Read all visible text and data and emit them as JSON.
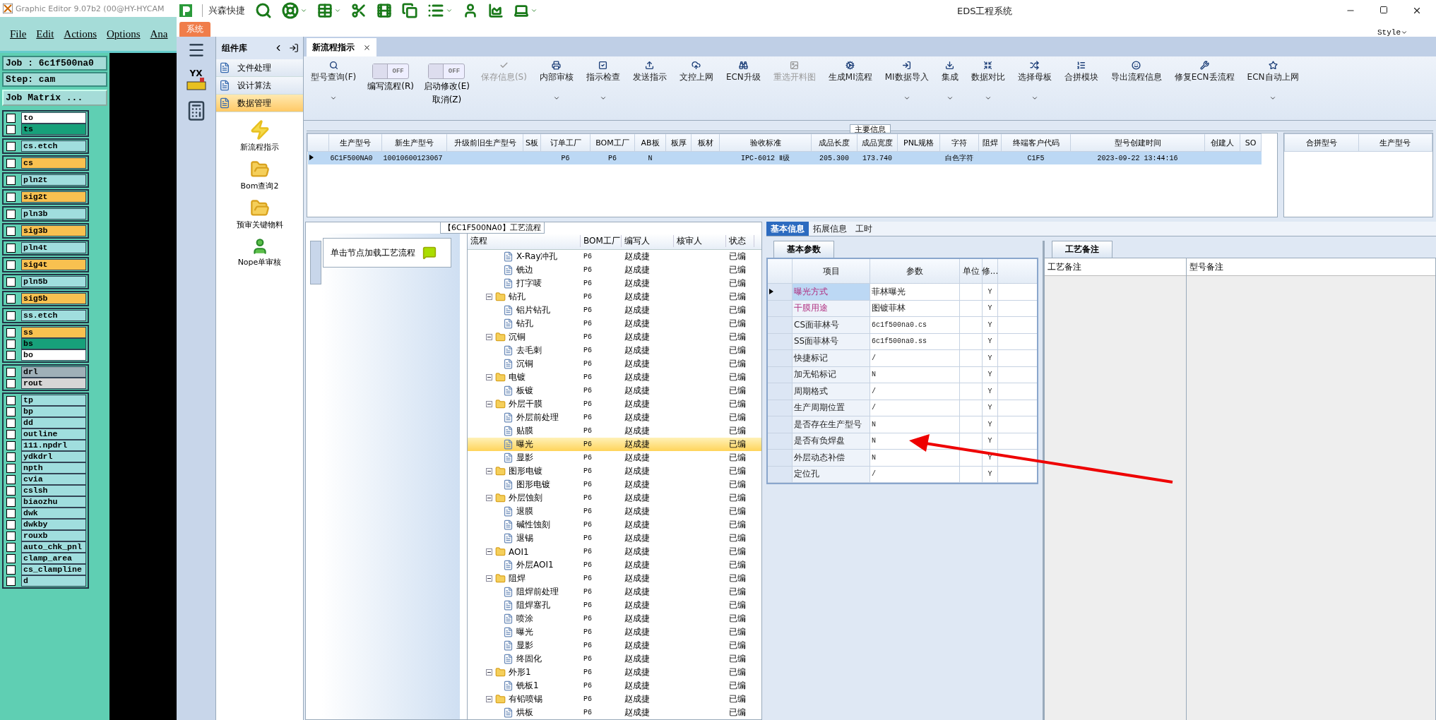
{
  "graphic_editor": {
    "title": "Graphic Editor 9.07b2 (00@HY-HYCAM",
    "menu": [
      "File",
      "Edit",
      "Actions",
      "Options",
      "Ana"
    ],
    "job": "Job : 6c1f500na0",
    "step": "Step: cam",
    "matrix_button": "Job Matrix ...",
    "layer_groups": [
      [
        {
          "name": "to",
          "color": "#ffffff",
          "checked": false
        },
        {
          "name": "ts",
          "color": "#17a07a",
          "checked": false
        }
      ],
      [
        {
          "name": "cs.etch",
          "color": "#a0dede",
          "checked": false
        }
      ],
      [
        {
          "name": "cs",
          "color": "#f8c150",
          "checked": false
        }
      ],
      [
        {
          "name": "pln2t",
          "color": "#a0dede",
          "checked": false
        }
      ],
      [
        {
          "name": "sig2t",
          "color": "#f8c150",
          "checked": false
        }
      ],
      [
        {
          "name": "pln3b",
          "color": "#a0dede",
          "checked": false
        }
      ],
      [
        {
          "name": "sig3b",
          "color": "#f8c150",
          "checked": false
        }
      ],
      [
        {
          "name": "pln4t",
          "color": "#a0dede",
          "checked": false
        }
      ],
      [
        {
          "name": "sig4t",
          "color": "#f8c150",
          "checked": false
        }
      ],
      [
        {
          "name": "pln5b",
          "color": "#a0dede",
          "checked": false
        }
      ],
      [
        {
          "name": "sig5b",
          "color": "#f8c150",
          "checked": false
        }
      ],
      [
        {
          "name": "ss.etch",
          "color": "#a0dede",
          "checked": false
        }
      ],
      [
        {
          "name": "ss",
          "color": "#f8c150",
          "checked": false
        },
        {
          "name": "bs",
          "color": "#17a07a",
          "checked": false
        },
        {
          "name": "bo",
          "color": "#ffffff",
          "checked": false
        }
      ],
      [
        {
          "name": "drl",
          "color": "#9fb0b8",
          "checked": false
        },
        {
          "name": "rout",
          "color": "#d6d6d6",
          "checked": false
        }
      ],
      [
        {
          "name": "tp",
          "color": "#a0dede",
          "checked": false
        },
        {
          "name": "bp",
          "color": "#a0dede",
          "checked": false
        },
        {
          "name": "dd",
          "color": "#a0dede",
          "checked": false
        },
        {
          "name": "outline",
          "color": "#a0dede",
          "checked": false
        },
        {
          "name": "111.npdrl",
          "color": "#a0dede",
          "checked": false
        },
        {
          "name": "ydkdrl",
          "color": "#a0dede",
          "checked": false
        },
        {
          "name": "npth",
          "color": "#a0dede",
          "checked": false
        },
        {
          "name": "cvia",
          "color": "#a0dede",
          "checked": false
        },
        {
          "name": "cslsh",
          "color": "#a0dede",
          "checked": false
        },
        {
          "name": "biaozhu",
          "color": "#a0dede",
          "checked": false
        },
        {
          "name": "dwk",
          "color": "#a0dede",
          "checked": false
        },
        {
          "name": "dwkby",
          "color": "#a0dede",
          "checked": false
        },
        {
          "name": "rouxb",
          "color": "#a0dede",
          "checked": false
        },
        {
          "name": "auto_chk_pnl",
          "color": "#a0dede",
          "checked": false
        },
        {
          "name": "clamp_area",
          "color": "#a0dede",
          "checked": false
        },
        {
          "name": "cs_clampline",
          "color": "#a0dede",
          "checked": false
        },
        {
          "name": "d",
          "color": "#a0dede",
          "checked": false
        }
      ]
    ]
  },
  "window": {
    "brand": "兴森快捷",
    "title": "EDS工程系统",
    "ribbon_tab": "系统",
    "logo_text": "YX",
    "style_menu": "Style"
  },
  "component_library": {
    "title": "组件库",
    "items": [
      {
        "label": "文件处理",
        "selected": false
      },
      {
        "label": "设计算法",
        "selected": false
      },
      {
        "label": "数据管理",
        "selected": true
      }
    ],
    "tools": [
      "新流程指示",
      "Bom查询2",
      "预审关键物料",
      "Nope单审核"
    ]
  },
  "document_tab": "新流程指示",
  "toolbar": [
    {
      "kind": "button",
      "label": "型号查询(F)",
      "dropdown": true,
      "disabled": false
    },
    {
      "kind": "toggle",
      "on": false,
      "state_text": "OFF",
      "lines": [
        "编写流程(R)"
      ]
    },
    {
      "kind": "toggle",
      "on": false,
      "state_text": "OFF",
      "lines": [
        "启动修改(E)",
        "取消(Z)"
      ]
    },
    {
      "kind": "button",
      "label": "保存信息(S)",
      "dropdown": false,
      "disabled": true
    },
    {
      "kind": "button",
      "label": "内部审核",
      "dropdown": true,
      "disabled": false
    },
    {
      "kind": "button",
      "label": "指示检查",
      "dropdown": true,
      "disabled": false
    },
    {
      "kind": "button",
      "label": "发送指示",
      "dropdown": false,
      "disabled": false
    },
    {
      "kind": "button",
      "label": "文控上网",
      "dropdown": false,
      "disabled": false
    },
    {
      "kind": "button",
      "label": "ECN升级",
      "dropdown": false,
      "disabled": false
    },
    {
      "kind": "button",
      "label": "重选开料图",
      "dropdown": false,
      "disabled": true
    },
    {
      "kind": "button",
      "label": "生成MI流程",
      "dropdown": false,
      "disabled": false
    },
    {
      "kind": "button",
      "label": "MI数据导入",
      "dropdown": true,
      "disabled": false
    },
    {
      "kind": "button",
      "label": "集成",
      "dropdown": true,
      "disabled": false
    },
    {
      "kind": "button",
      "label": "数据对比",
      "dropdown": true,
      "disabled": false
    },
    {
      "kind": "button",
      "label": "选择母板",
      "dropdown": true,
      "disabled": false
    },
    {
      "kind": "button",
      "label": "合拼模块",
      "dropdown": false,
      "disabled": false
    },
    {
      "kind": "button",
      "label": "导出流程信息",
      "dropdown": false,
      "disabled": false
    },
    {
      "kind": "button",
      "label": "修复ECN丢流程",
      "dropdown": false,
      "disabled": false
    },
    {
      "kind": "button",
      "label": "ECN自动上网",
      "dropdown": true,
      "disabled": false
    }
  ],
  "main_info": {
    "caption": "主要信息",
    "columns": [
      "生产型号",
      "新生产型号",
      "升级前旧生产型号",
      "S板",
      "订单工厂",
      "BOM工厂",
      "AB板",
      "板厚",
      "板材",
      "验收标准",
      "成品长度",
      "成品宽度",
      "PNL规格",
      "字符",
      "阻焊",
      "终端客户代码",
      "型号创建时间",
      "创建人",
      "SO"
    ],
    "rows": [
      {
        "selected": true,
        "cells": [
          "6C1F500NA0",
          "10010600123067",
          null,
          null,
          "P6",
          "P6",
          "N",
          null,
          null,
          "IPC-6012 Ⅱ级",
          "205.300",
          "173.740",
          null,
          "白色字符",
          null,
          "C1F5",
          "2023-09-22 13:44:16",
          null,
          null
        ]
      }
    ],
    "side_columns": [
      "合拼型号",
      "生产型号"
    ]
  },
  "process": {
    "title": "【6C1F500NA0】工艺流程",
    "hint": "单击节点加载工艺流程",
    "columns": [
      "流程",
      "BOM工厂",
      "编写人",
      "核审人",
      "状态"
    ],
    "tree": [
      {
        "kind": "leaf",
        "name": "X-Ray冲孔",
        "bom": "P6",
        "writer": "赵成捷",
        "status": "已编",
        "selected": false
      },
      {
        "kind": "leaf",
        "name": "铣边",
        "bom": "P6",
        "writer": "赵成捷",
        "status": "已编",
        "selected": false
      },
      {
        "kind": "leaf",
        "name": "打字唛",
        "bom": "P6",
        "writer": "赵成捷",
        "status": "已编",
        "selected": false
      },
      {
        "kind": "folder",
        "name": "钻孔",
        "bom": "P6",
        "writer": "赵成捷",
        "status": "已编",
        "selected": false,
        "expanded": true,
        "children": [
          {
            "kind": "leaf",
            "name": "铝片钻孔",
            "bom": "P6",
            "writer": "赵成捷",
            "status": "已编",
            "selected": false
          },
          {
            "kind": "leaf",
            "name": "钻孔",
            "bom": "P6",
            "writer": "赵成捷",
            "status": "已编",
            "selected": false
          }
        ]
      },
      {
        "kind": "folder",
        "name": "沉铜",
        "bom": "P6",
        "writer": "赵成捷",
        "status": "已编",
        "selected": false,
        "expanded": true,
        "children": [
          {
            "kind": "leaf",
            "name": "去毛刺",
            "bom": "P6",
            "writer": "赵成捷",
            "status": "已编",
            "selected": false
          },
          {
            "kind": "leaf",
            "name": "沉铜",
            "bom": "P6",
            "writer": "赵成捷",
            "status": "已编",
            "selected": false
          }
        ]
      },
      {
        "kind": "folder",
        "name": "电镀",
        "bom": "P6",
        "writer": "赵成捷",
        "status": "已编",
        "selected": false,
        "expanded": true,
        "children": [
          {
            "kind": "leaf",
            "name": "板镀",
            "bom": "P6",
            "writer": "赵成捷",
            "status": "已编",
            "selected": false
          }
        ]
      },
      {
        "kind": "folder",
        "name": "外层干膜",
        "bom": "P6",
        "writer": "赵成捷",
        "status": "已编",
        "selected": false,
        "expanded": true,
        "children": [
          {
            "kind": "leaf",
            "name": "外层前处理",
            "bom": "P6",
            "writer": "赵成捷",
            "status": "已编",
            "selected": false
          },
          {
            "kind": "leaf",
            "name": "贴膜",
            "bom": "P6",
            "writer": "赵成捷",
            "status": "已编",
            "selected": false
          },
          {
            "kind": "leaf",
            "name": "曝光",
            "bom": "P6",
            "writer": "赵成捷",
            "status": "已编",
            "selected": true
          },
          {
            "kind": "leaf",
            "name": "显影",
            "bom": "P6",
            "writer": "赵成捷",
            "status": "已编",
            "selected": false
          }
        ]
      },
      {
        "kind": "folder",
        "name": "图形电镀",
        "bom": "P6",
        "writer": "赵成捷",
        "status": "已编",
        "selected": false,
        "expanded": true,
        "children": [
          {
            "kind": "leaf",
            "name": "图形电镀",
            "bom": "P6",
            "writer": "赵成捷",
            "status": "已编",
            "selected": false
          }
        ]
      },
      {
        "kind": "folder",
        "name": "外层蚀刻",
        "bom": "P6",
        "writer": "赵成捷",
        "status": "已编",
        "selected": false,
        "expanded": true,
        "children": [
          {
            "kind": "leaf",
            "name": "退膜",
            "bom": "P6",
            "writer": "赵成捷",
            "status": "已编",
            "selected": false
          },
          {
            "kind": "leaf",
            "name": "碱性蚀刻",
            "bom": "P6",
            "writer": "赵成捷",
            "status": "已编",
            "selected": false
          },
          {
            "kind": "leaf",
            "name": "退锡",
            "bom": "P6",
            "writer": "赵成捷",
            "status": "已编",
            "selected": false
          }
        ]
      },
      {
        "kind": "folder",
        "name": "AOI1",
        "bom": "P6",
        "writer": "赵成捷",
        "status": "已编",
        "selected": false,
        "expanded": true,
        "children": [
          {
            "kind": "leaf",
            "name": "外层AOI1",
            "bom": "P6",
            "writer": "赵成捷",
            "status": "已编",
            "selected": false
          }
        ]
      },
      {
        "kind": "folder",
        "name": "阻焊",
        "bom": "P6",
        "writer": "赵成捷",
        "status": "已编",
        "selected": false,
        "expanded": true,
        "children": [
          {
            "kind": "leaf",
            "name": "阻焊前处理",
            "bom": "P6",
            "writer": "赵成捷",
            "status": "已编",
            "selected": false
          },
          {
            "kind": "leaf",
            "name": "阻焊塞孔",
            "bom": "P6",
            "writer": "赵成捷",
            "status": "已编",
            "selected": false
          },
          {
            "kind": "leaf",
            "name": "喷涂",
            "bom": "P6",
            "writer": "赵成捷",
            "status": "已编",
            "selected": false
          },
          {
            "kind": "leaf",
            "name": "曝光",
            "bom": "P6",
            "writer": "赵成捷",
            "status": "已编",
            "selected": false
          },
          {
            "kind": "leaf",
            "name": "显影",
            "bom": "P6",
            "writer": "赵成捷",
            "status": "已编",
            "selected": false
          },
          {
            "kind": "leaf",
            "name": "终固化",
            "bom": "P6",
            "writer": "赵成捷",
            "status": "已编",
            "selected": false
          }
        ]
      },
      {
        "kind": "folder",
        "name": "外形1",
        "bom": "P6",
        "writer": "赵成捷",
        "status": "已编",
        "selected": false,
        "expanded": true,
        "children": [
          {
            "kind": "leaf",
            "name": "铣板1",
            "bom": "P6",
            "writer": "赵成捷",
            "status": "已编",
            "selected": false
          }
        ]
      },
      {
        "kind": "folder",
        "name": "有铅喷锡",
        "bom": "P6",
        "writer": "赵成捷",
        "status": "已编",
        "selected": false,
        "expanded": true,
        "children": [
          {
            "kind": "leaf",
            "name": "烘板",
            "bom": "P6",
            "writer": "赵成捷",
            "status": "已编",
            "selected": false
          }
        ]
      }
    ]
  },
  "detail_tabs": [
    {
      "label": "基本信息",
      "selected": true
    },
    {
      "label": "拓展信息",
      "selected": false
    },
    {
      "label": "工时",
      "selected": false
    }
  ],
  "basic_params": {
    "tab": "基本参数",
    "columns": [
      "项目",
      "参数",
      "单位",
      "修..."
    ],
    "rows": [
      {
        "item": "曝光方式",
        "value": "菲林曝光",
        "flag": "Y",
        "emphasis": true,
        "selected": true
      },
      {
        "item": "干膜用途",
        "value": "图镀菲林",
        "flag": "Y",
        "emphasis": true,
        "selected": false
      },
      {
        "item": "CS面菲林号",
        "value": "6c1f500na0.cs",
        "flag": "Y",
        "emphasis": false,
        "selected": false
      },
      {
        "item": "SS面菲林号",
        "value": "6c1f500na0.ss",
        "flag": "Y",
        "emphasis": false,
        "selected": false
      },
      {
        "item": "快捷标记",
        "value": "/",
        "flag": "Y",
        "emphasis": false,
        "selected": false
      },
      {
        "item": "加无铅标记",
        "value": "N",
        "flag": "Y",
        "emphasis": false,
        "selected": false
      },
      {
        "item": "周期格式",
        "value": "/",
        "flag": "Y",
        "emphasis": false,
        "selected": false
      },
      {
        "item": "生产周期位置",
        "value": "/",
        "flag": "Y",
        "emphasis": false,
        "selected": false
      },
      {
        "item": "是否存在生产型号",
        "value": "N",
        "flag": "Y",
        "emphasis": false,
        "selected": false
      },
      {
        "item": "是否有负焊盘",
        "value": "N",
        "flag": "Y",
        "emphasis": false,
        "selected": false
      },
      {
        "item": "外层动态补偿",
        "value": "N",
        "flag": "Y",
        "emphasis": false,
        "selected": false
      },
      {
        "item": "定位孔",
        "value": "/",
        "flag": "Y",
        "emphasis": false,
        "selected": false
      }
    ]
  },
  "remarks": {
    "tab": "工艺备注",
    "columns": [
      "工艺备注",
      "型号备注"
    ]
  }
}
